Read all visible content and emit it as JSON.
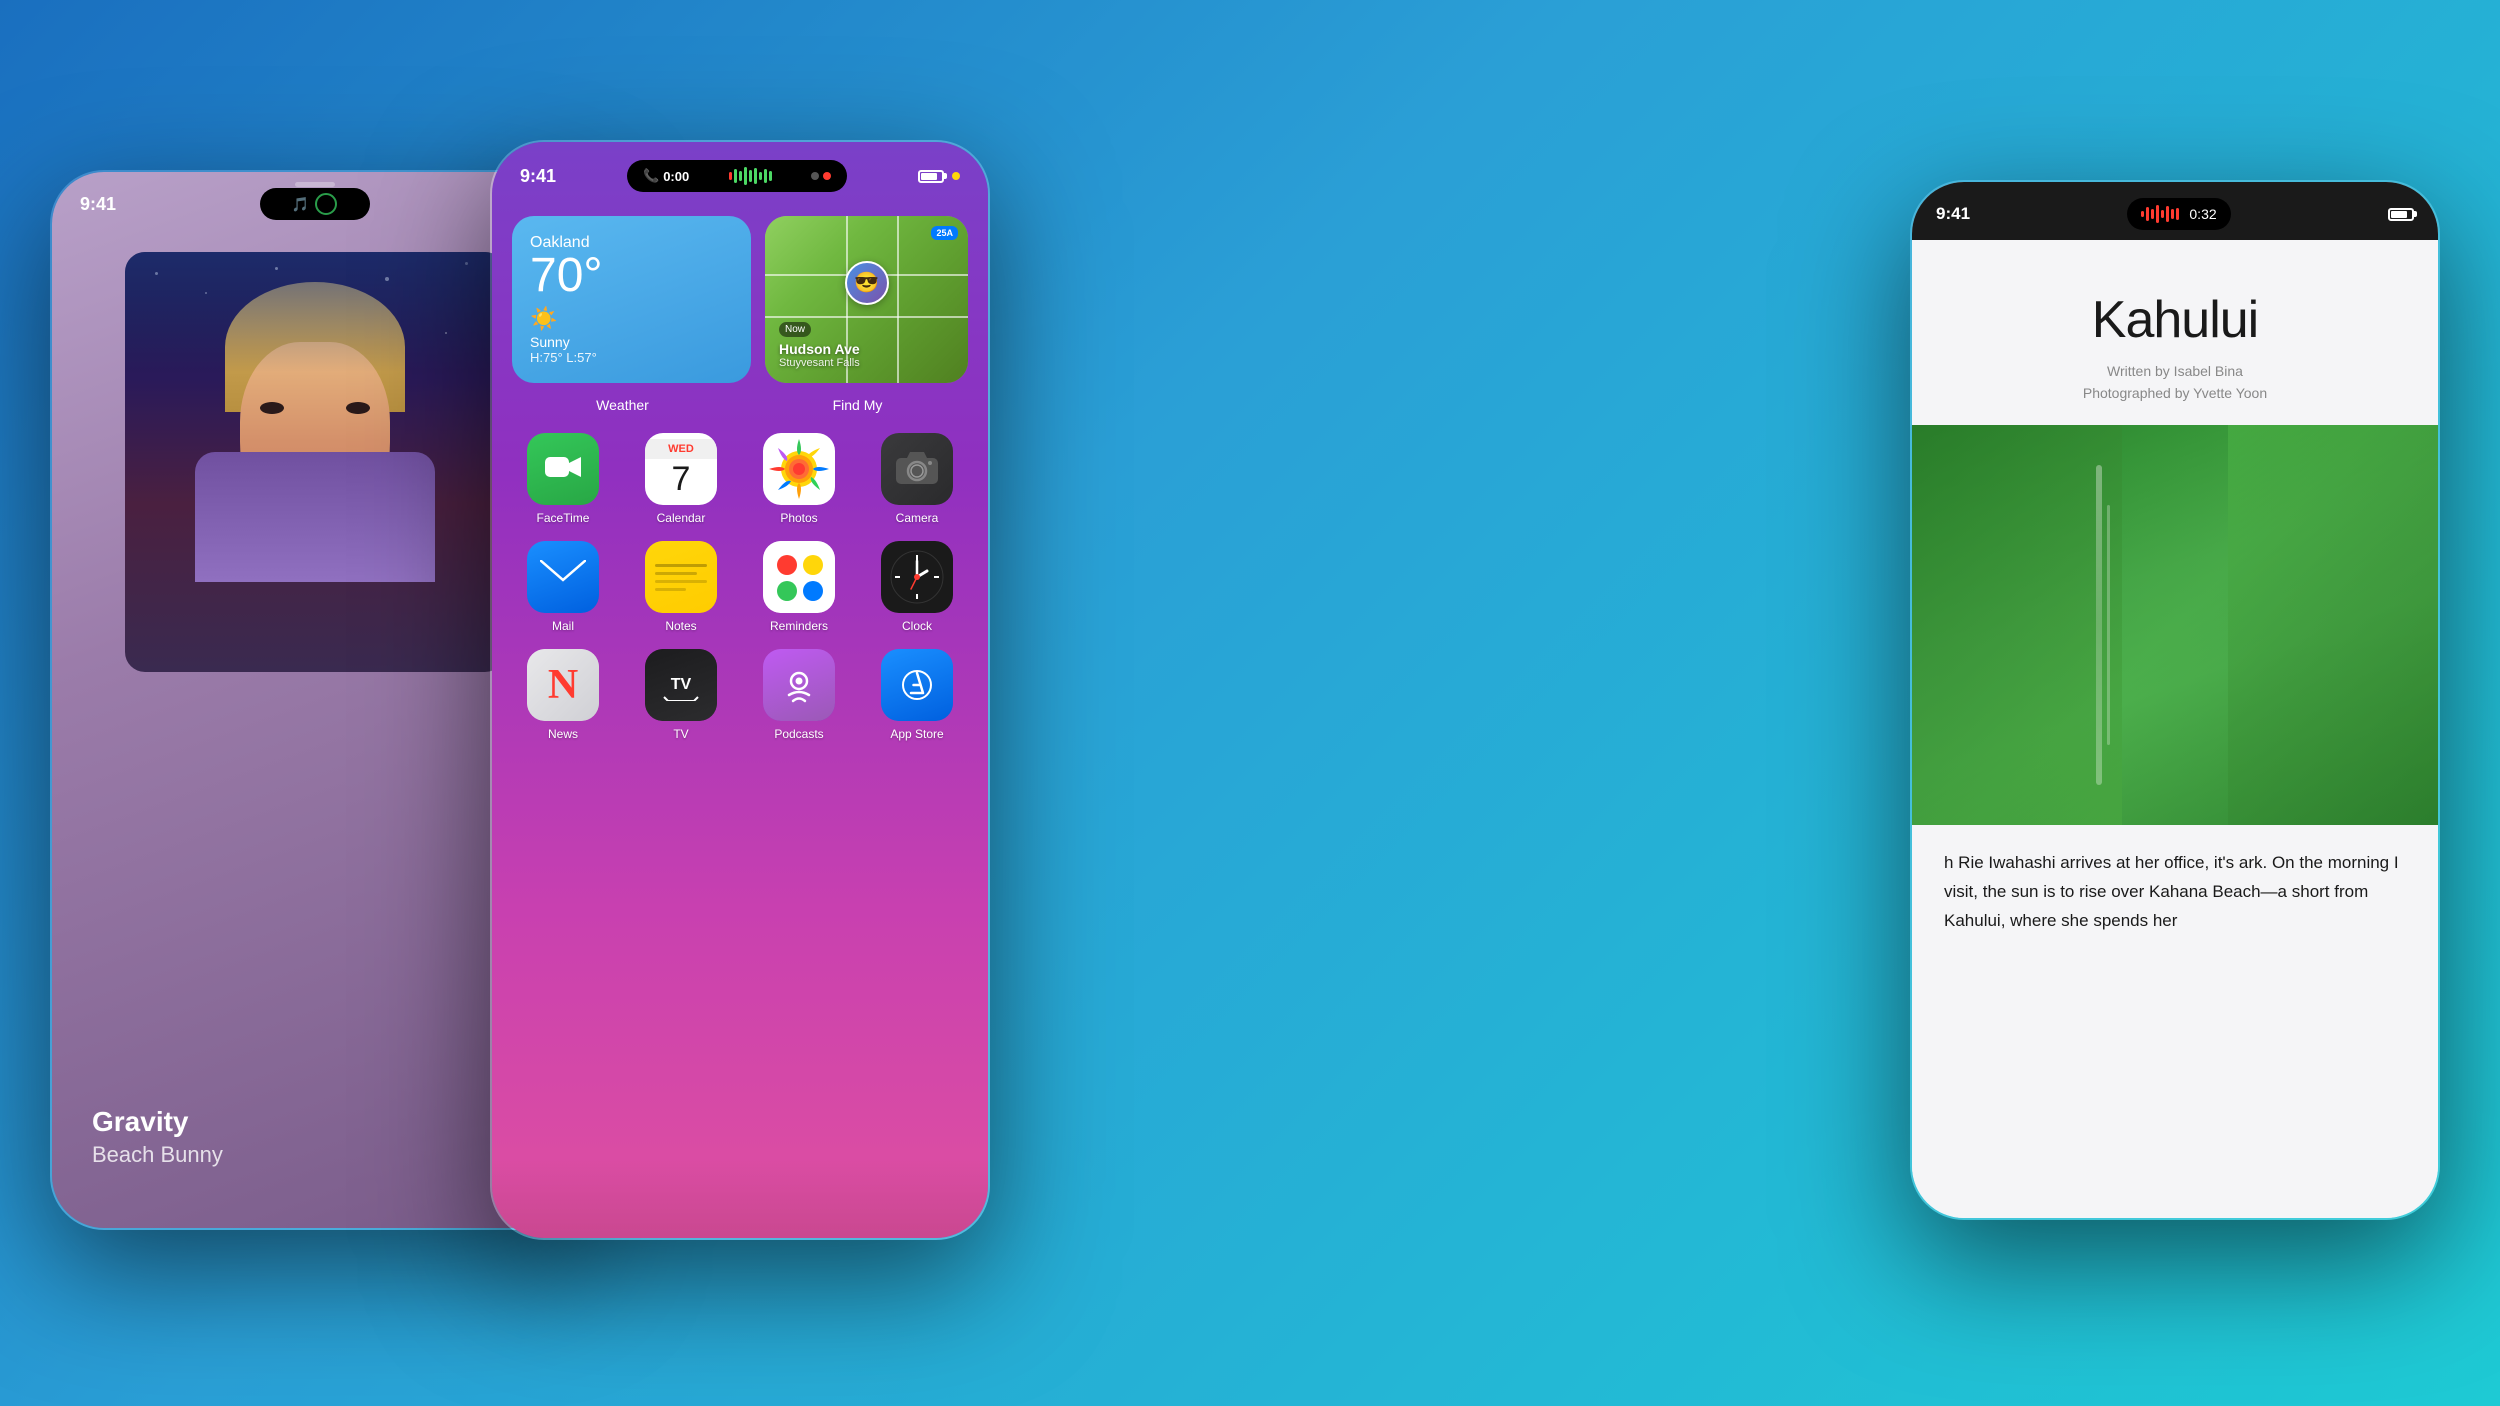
{
  "background": {
    "gradient": "linear-gradient(135deg, #1a6fbf 0%, #2a9fd6 40%, #1ecad4 100%)"
  },
  "left_phone": {
    "time": "9:41",
    "dynamic_island": {
      "icon": "🎵",
      "ring_icon": "⏺"
    },
    "music": {
      "song_title": "Gravity",
      "artist": "Beach Bunny"
    },
    "signal": "●●●●",
    "status_icons": "📶"
  },
  "center_phone": {
    "time": "9:41",
    "dynamic_island": {
      "call_label": "0:00",
      "waveform_label": "audio waveform",
      "dot_color": "#ff3b30"
    },
    "battery_percent": "100",
    "widgets": {
      "weather": {
        "city": "Oakland",
        "temperature": "70°",
        "condition": "Sunny",
        "hi_lo": "H:75° L:57°",
        "label": "Weather"
      },
      "find_my": {
        "now": "Now",
        "street": "Hudson Ave",
        "city": "Stuyvesant Falls",
        "label": "Find My",
        "route_badge": "25A"
      }
    },
    "apps": [
      {
        "name": "FaceTime",
        "icon": "facetime"
      },
      {
        "name": "Calendar",
        "icon": "calendar",
        "day_name": "WED",
        "day_num": "7"
      },
      {
        "name": "Photos",
        "icon": "photos"
      },
      {
        "name": "Camera",
        "icon": "camera"
      },
      {
        "name": "Mail",
        "icon": "mail"
      },
      {
        "name": "Notes",
        "icon": "notes"
      },
      {
        "name": "Reminders",
        "icon": "reminders"
      },
      {
        "name": "Clock",
        "icon": "clock"
      },
      {
        "name": "News",
        "icon": "news"
      },
      {
        "name": "TV",
        "icon": "tv"
      },
      {
        "name": "Podcasts",
        "icon": "podcasts"
      },
      {
        "name": "App Store",
        "icon": "appstore"
      }
    ]
  },
  "right_phone": {
    "time": "9:41",
    "timer_label": "0:32",
    "dynamic_island": {
      "waveform_label": "audio",
      "timer": "0:32"
    },
    "article": {
      "title": "Kahului",
      "byline_line1": "Written by Isabel Bina",
      "byline_line2": "Photographed by Yvette Yoon",
      "body": "h Rie Iwahashi arrives at her office, it's ark. On the morning I visit, the sun is  to rise over Kahana Beach—a short  from Kahului, where she spends her"
    }
  }
}
